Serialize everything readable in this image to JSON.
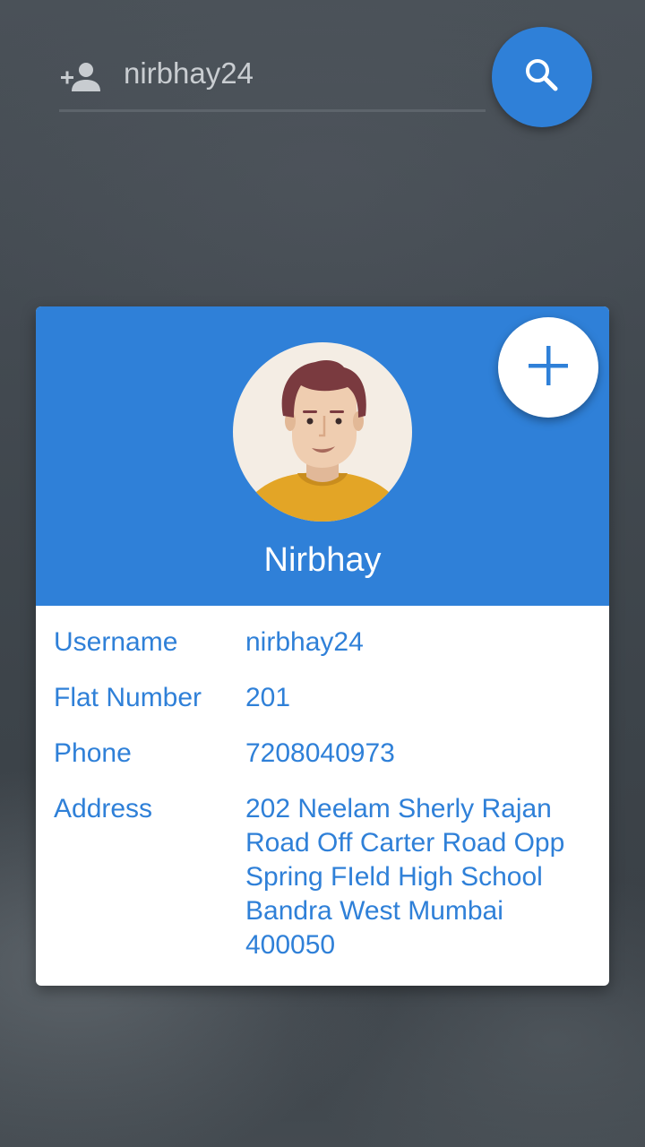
{
  "search": {
    "value": "nirbhay24",
    "icon": "add-user-icon",
    "button_icon": "search-icon"
  },
  "profile": {
    "name": "Nirbhay",
    "avatar_icon": "avatar-man-illustration",
    "add_button_icon": "plus-icon"
  },
  "details": [
    {
      "label": "Username",
      "value": "nirbhay24"
    },
    {
      "label": "Flat Number",
      "value": "201"
    },
    {
      "label": "Phone",
      "value": "7208040973"
    },
    {
      "label": "Address",
      "value": "202 Neelam Sherly Rajan Road Off Carter Road Opp Spring FIeld High School Bandra West Mumbai 400050"
    }
  ],
  "colors": {
    "accent": "#2f80d8",
    "card_background": "#ffffff",
    "text_on_accent": "#ffffff"
  }
}
